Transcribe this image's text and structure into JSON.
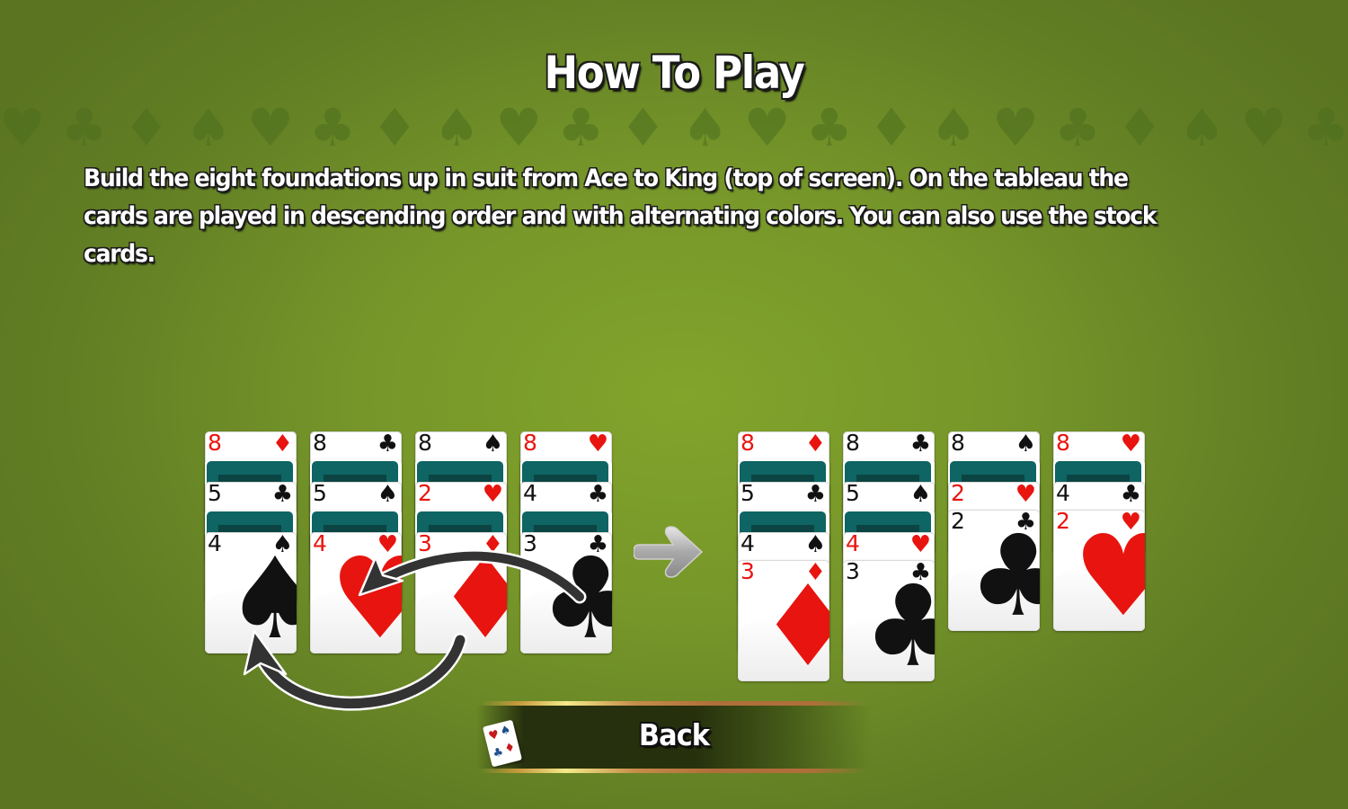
{
  "title": "How To Play",
  "background_suits": [
    "♥",
    "♣",
    "♦",
    "♠",
    "♥",
    "♣",
    "♦",
    "♠",
    "♥",
    "♣",
    "♦",
    "♠",
    "♥",
    "♣",
    "♦",
    "♠",
    "♥",
    "♣",
    "♦",
    "♠",
    "♥",
    "♣"
  ],
  "description": "Build the eight foundations up in suit from Ace to King (top of screen). On the tableau the cards are played in descending order and with alternating colors. You can also use the stock cards.",
  "colors": {
    "red_suit": "#e8140f",
    "black_suit": "#111111",
    "card_back": "#0e6563",
    "felt": "#76962a"
  },
  "illustration": {
    "before": {
      "columns": [
        {
          "stack": [
            {
              "rank": "8",
              "suit": "♦",
              "color": "red"
            },
            {
              "back": true
            },
            {
              "rank": "5",
              "suit": "♣",
              "color": "black"
            },
            {
              "back": true
            },
            {
              "rank": "4",
              "suit": "♠",
              "color": "black"
            }
          ]
        },
        {
          "stack": [
            {
              "rank": "8",
              "suit": "♣",
              "color": "black"
            },
            {
              "back": true
            },
            {
              "rank": "5",
              "suit": "♠",
              "color": "black"
            },
            {
              "back": true
            },
            {
              "rank": "4",
              "suit": "♥",
              "color": "red"
            }
          ]
        },
        {
          "stack": [
            {
              "rank": "8",
              "suit": "♠",
              "color": "black"
            },
            {
              "back": true
            },
            {
              "rank": "2",
              "suit": "♥",
              "color": "red"
            },
            {
              "back": true
            },
            {
              "rank": "3",
              "suit": "♦",
              "color": "red"
            }
          ]
        },
        {
          "stack": [
            {
              "rank": "8",
              "suit": "♥",
              "color": "red"
            },
            {
              "back": true
            },
            {
              "rank": "4",
              "suit": "♣",
              "color": "black"
            },
            {
              "back": true
            },
            {
              "rank": "3",
              "suit": "♣",
              "color": "black"
            }
          ]
        }
      ],
      "moves": [
        {
          "from_column": 4,
          "to_column": 2,
          "card": "3♣"
        },
        {
          "from_column": 3,
          "to_column": 1,
          "card": "3♦"
        }
      ]
    },
    "transition_icon": "arrow-right-icon",
    "after": {
      "columns": [
        {
          "stack": [
            {
              "rank": "8",
              "suit": "♦",
              "color": "red"
            },
            {
              "back": true
            },
            {
              "rank": "5",
              "suit": "♣",
              "color": "black"
            },
            {
              "back": true
            },
            {
              "rank": "4",
              "suit": "♠",
              "color": "black"
            },
            {
              "rank": "3",
              "suit": "♦",
              "color": "red"
            }
          ]
        },
        {
          "stack": [
            {
              "rank": "8",
              "suit": "♣",
              "color": "black"
            },
            {
              "back": true
            },
            {
              "rank": "5",
              "suit": "♠",
              "color": "black"
            },
            {
              "back": true
            },
            {
              "rank": "4",
              "suit": "♥",
              "color": "red"
            },
            {
              "rank": "3",
              "suit": "♣",
              "color": "black"
            }
          ]
        },
        {
          "stack": [
            {
              "rank": "8",
              "suit": "♠",
              "color": "black"
            },
            {
              "back": true
            },
            {
              "rank": "2",
              "suit": "♥",
              "color": "red"
            },
            {
              "rank": "2",
              "suit": "♣",
              "color": "black"
            }
          ]
        },
        {
          "stack": [
            {
              "rank": "8",
              "suit": "♥",
              "color": "red"
            },
            {
              "back": true
            },
            {
              "rank": "4",
              "suit": "♣",
              "color": "black"
            },
            {
              "rank": "2",
              "suit": "♥",
              "color": "red"
            }
          ]
        }
      ]
    }
  },
  "back_button": {
    "label": "Back",
    "icon": "playing-card-icon",
    "icon_suits": [
      "♥",
      "♠",
      "♣",
      "♦"
    ]
  }
}
